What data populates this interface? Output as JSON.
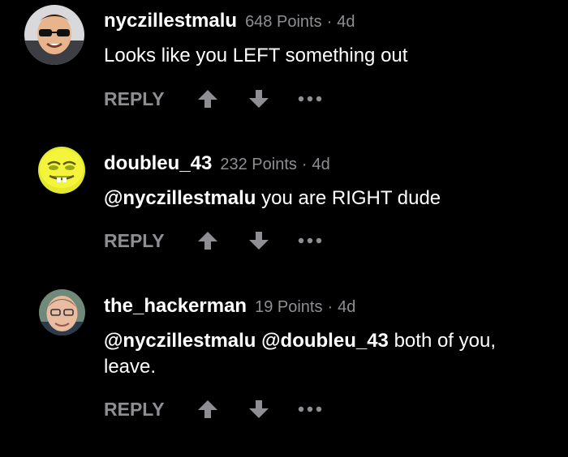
{
  "icons": {
    "upvote": "arrow-up-icon",
    "downvote": "arrow-down-icon",
    "more": "more-dots-icon"
  },
  "colors": {
    "background": "#000000",
    "text": "#ffffff",
    "muted": "#8e8e93"
  },
  "comments": [
    {
      "username": "nyczillestmalu",
      "points": "648 Points",
      "separator": "·",
      "age": "4d",
      "text": "Looks like you LEFT something out",
      "reply_label": "REPLY"
    },
    {
      "username": "doubleu_43",
      "points": "232 Points",
      "separator": "·",
      "age": "4d",
      "mention": "@nyczillestmalu",
      "text": " you are RIGHT dude",
      "reply_label": "REPLY"
    },
    {
      "username": "the_hackerman",
      "points": "19 Points",
      "separator": "·",
      "age": "4d",
      "mention1": "@nyczillestmalu",
      "mention2": "@doubleu_43",
      "text": " both of you, leave.",
      "reply_label": "REPLY"
    }
  ]
}
